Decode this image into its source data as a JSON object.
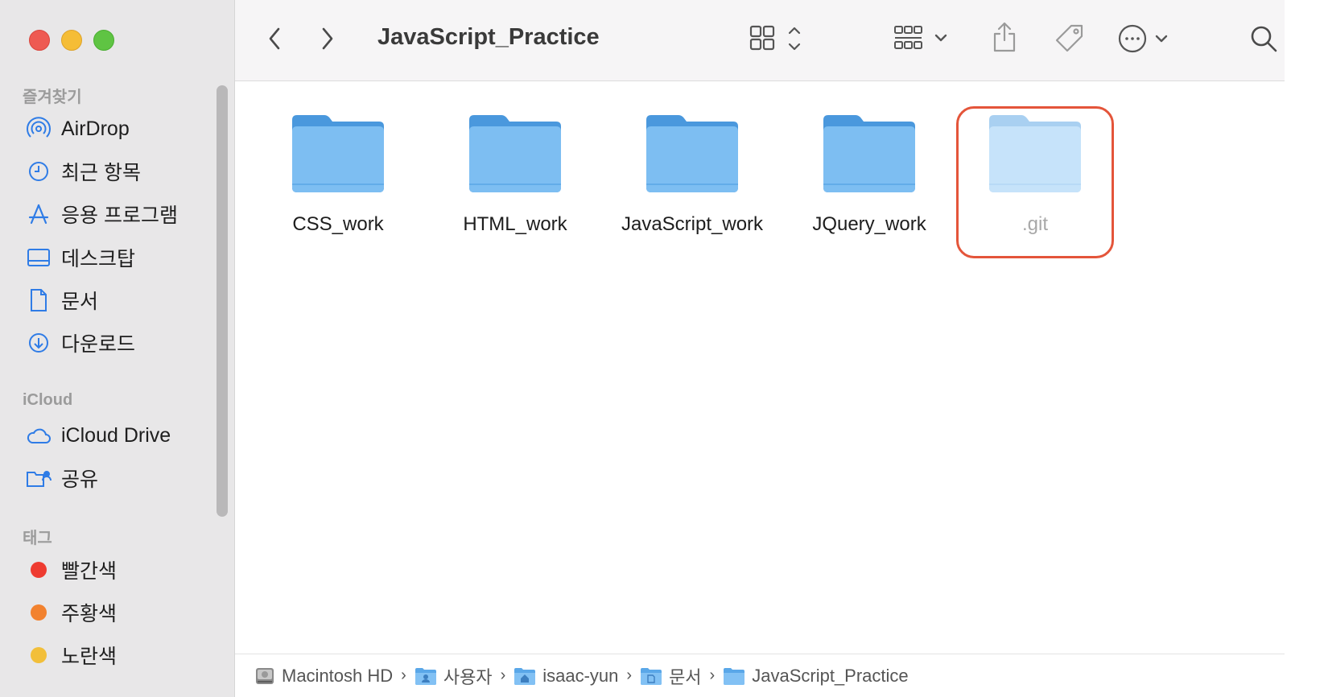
{
  "window": {
    "title": "JavaScript_Practice"
  },
  "sidebar": {
    "favorites_header": "즐겨찾기",
    "favorites": [
      {
        "label": "AirDrop",
        "icon": "airdrop-icon"
      },
      {
        "label": "최근 항목",
        "icon": "clock-icon"
      },
      {
        "label": "응용 프로그램",
        "icon": "applications-icon"
      },
      {
        "label": "데스크탑",
        "icon": "desktop-icon"
      },
      {
        "label": "문서",
        "icon": "document-icon"
      },
      {
        "label": "다운로드",
        "icon": "download-icon"
      }
    ],
    "icloud_header": "iCloud",
    "icloud": [
      {
        "label": "iCloud Drive",
        "icon": "cloud-icon"
      },
      {
        "label": "공유",
        "icon": "shared-folder-icon"
      }
    ],
    "tags_header": "태그",
    "tags": [
      {
        "label": "빨간색",
        "color": "#ee3b30"
      },
      {
        "label": "주황색",
        "color": "#f2822f"
      },
      {
        "label": "노란색",
        "color": "#f2bf3a"
      }
    ]
  },
  "content": {
    "folders": [
      {
        "label": "CSS_work",
        "hidden": false
      },
      {
        "label": "HTML_work",
        "hidden": false
      },
      {
        "label": "JavaScript_work",
        "hidden": false
      },
      {
        "label": "JQuery_work",
        "hidden": false
      },
      {
        "label": ".git",
        "hidden": true
      }
    ],
    "highlight_color": "#e4553a"
  },
  "pathbar": {
    "crumbs": [
      {
        "label": "Macintosh HD",
        "icon": "hard-drive-icon"
      },
      {
        "label": "사용자",
        "icon": "users-folder-icon"
      },
      {
        "label": "isaac-yun",
        "icon": "home-folder-icon"
      },
      {
        "label": "문서",
        "icon": "documents-folder-icon"
      },
      {
        "label": "JavaScript_Practice",
        "icon": "folder-icon"
      }
    ]
  }
}
